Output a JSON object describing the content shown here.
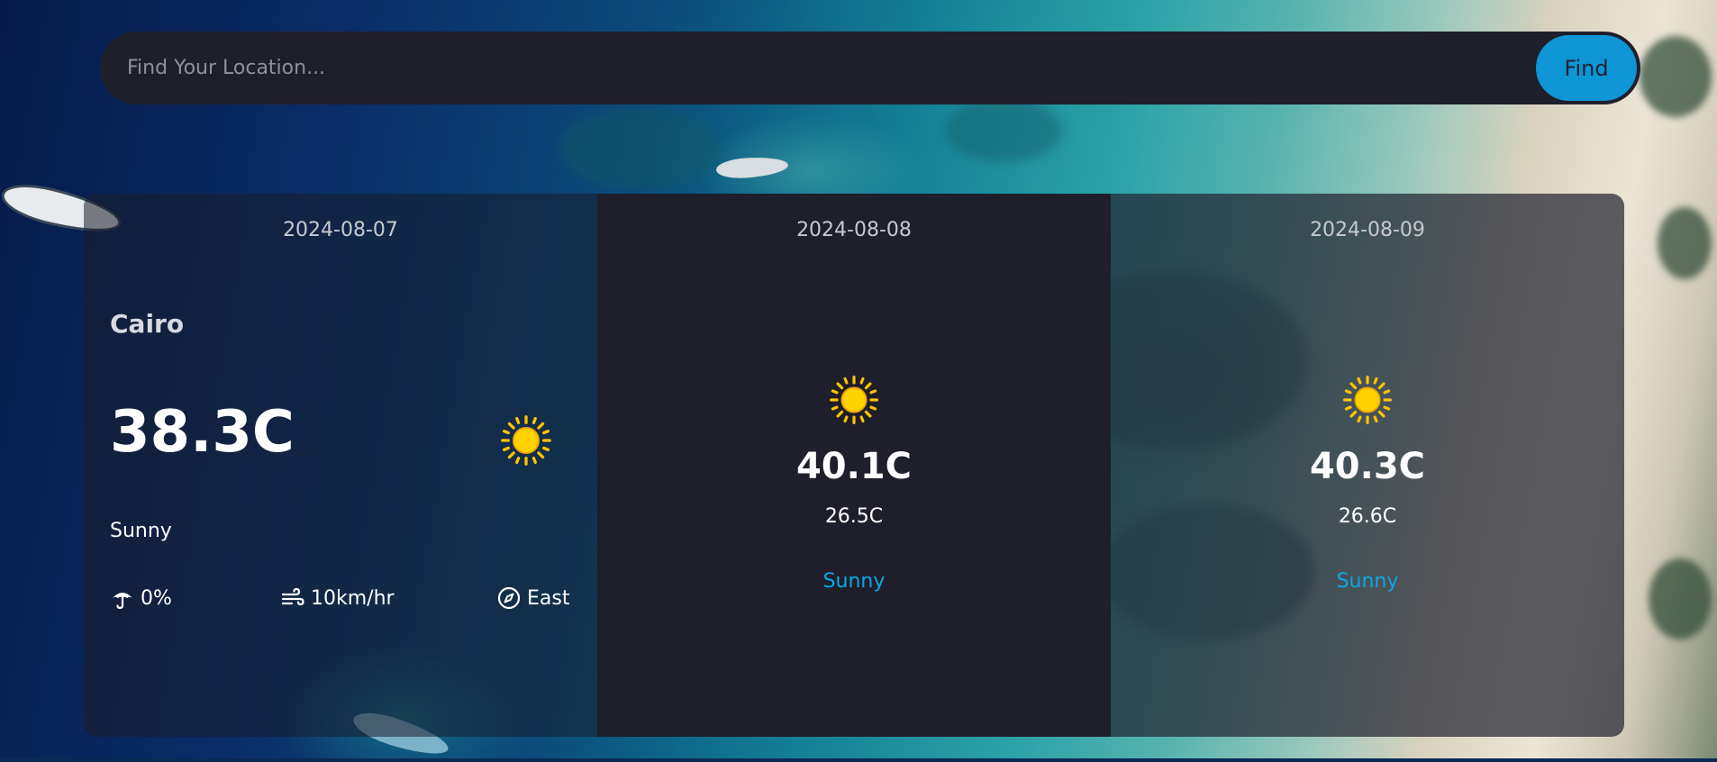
{
  "search": {
    "placeholder": "Find Your Location...",
    "button_label": "Find"
  },
  "today": {
    "date": "2024-08-07",
    "city": "Cairo",
    "temperature": "38.3C",
    "condition": "Sunny",
    "condition_icon": "sun-icon",
    "rain_chance": "0%",
    "wind_speed": "10km/hr",
    "wind_direction": "East"
  },
  "forecast": [
    {
      "date": "2024-08-08",
      "max_temp": "40.1C",
      "min_temp": "26.5C",
      "condition": "Sunny",
      "condition_icon": "sun-icon"
    },
    {
      "date": "2024-08-09",
      "max_temp": "40.3C",
      "min_temp": "26.6C",
      "condition": "Sunny",
      "condition_icon": "sun-icon"
    }
  ],
  "colors": {
    "accent": "#0d95d6",
    "condition_text": "#0fa6e3",
    "card_dark": "#1e1f2b",
    "sun": "#ffc400"
  }
}
